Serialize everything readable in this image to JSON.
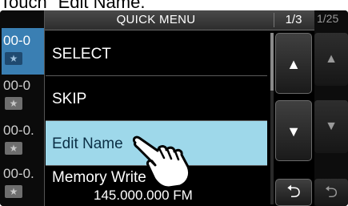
{
  "caption": "Touch \"Edit Name.\"",
  "background": {
    "channels": [
      {
        "label": "00-0",
        "selected": true
      },
      {
        "label": "00-0",
        "selected": false
      },
      {
        "label": "00-0.",
        "selected": false
      },
      {
        "label": "00-0.",
        "selected": false
      }
    ],
    "star_icon": "★",
    "right_count": "1/25",
    "up_icon": "▲",
    "down_icon": "▼",
    "back_icon": "⮌"
  },
  "menu": {
    "title": "QUICK MENU",
    "page": "1/3",
    "items": [
      {
        "label": "SELECT"
      },
      {
        "label": "SKIP"
      },
      {
        "label": "Edit Name"
      },
      {
        "label": "Memory Write",
        "sub": "145.000.000   FM"
      }
    ],
    "up_label": "▲",
    "down_label": "▼",
    "back_label": "⮌"
  },
  "colors": {
    "highlight": "#9ed8ea",
    "selected_channel": "#3a7fb3",
    "screen_bg": "#000000"
  }
}
